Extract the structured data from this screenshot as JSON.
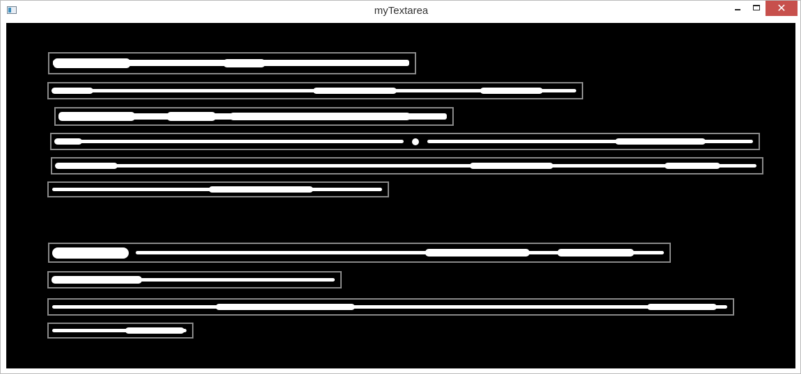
{
  "window": {
    "title": "myTextarea",
    "controls": {
      "minimize": "minimize",
      "maximize": "maximize",
      "close": "✕"
    }
  },
  "canvas": {
    "background": "#000000",
    "box_border_color": "#8a8a8a",
    "redacted_text_color": "#ffffff",
    "text_region_count": 11
  }
}
